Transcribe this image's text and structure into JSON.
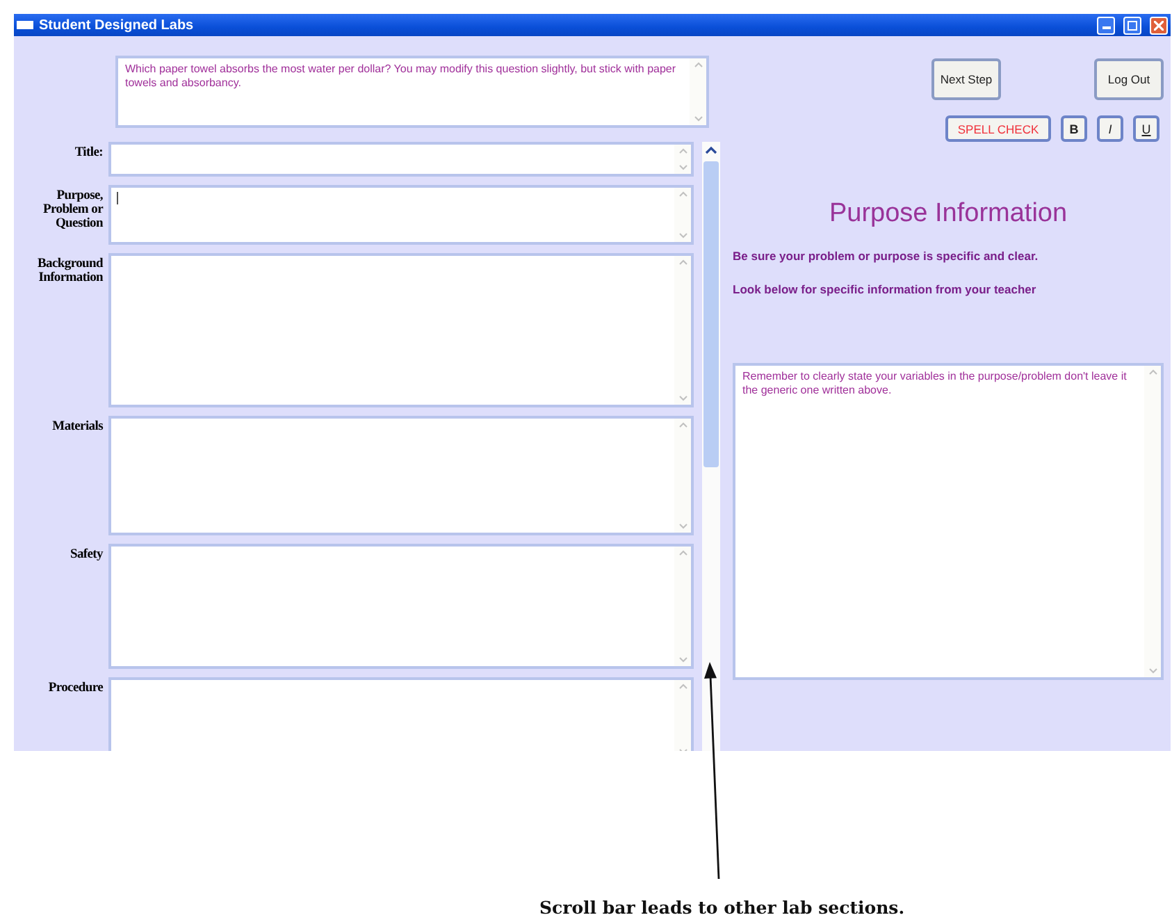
{
  "window": {
    "title": "Student Designed Labs"
  },
  "prompt": {
    "value": "Which paper towel absorbs the most water per dollar?  You may modify this question slightly, but stick with paper towels and absorbancy."
  },
  "fields": [
    {
      "label": [
        "Title:"
      ],
      "focused": false
    },
    {
      "label": [
        "Purpose,",
        "Problem or",
        "Question"
      ],
      "focused": true
    },
    {
      "label": [
        "Background",
        "Information"
      ],
      "focused": false
    },
    {
      "label": [
        "Materials"
      ],
      "focused": false
    },
    {
      "label": [
        "Safety"
      ],
      "focused": false
    },
    {
      "label": [
        "Procedure"
      ],
      "focused": false
    }
  ],
  "buttons": [
    {
      "label": "Next Step"
    },
    {
      "label": "Log Out"
    }
  ],
  "toolbar": [
    {
      "label": "SPELL CHECK",
      "kind": "spell"
    },
    {
      "label": "B",
      "kind": "bold"
    },
    {
      "label": "I",
      "kind": "italic"
    },
    {
      "label": "U",
      "kind": "underline"
    }
  ],
  "panel": {
    "heading": "Purpose Information",
    "notes": [
      "Be sure your problem or purpose is specific and clear.",
      "Look below for specific information from your teacher"
    ],
    "info": "Remember to clearly state your variables in the purpose/problem don't leave it the generic one written above."
  },
  "annotation": {
    "caption": "Scroll bar leads to other lab sections."
  }
}
